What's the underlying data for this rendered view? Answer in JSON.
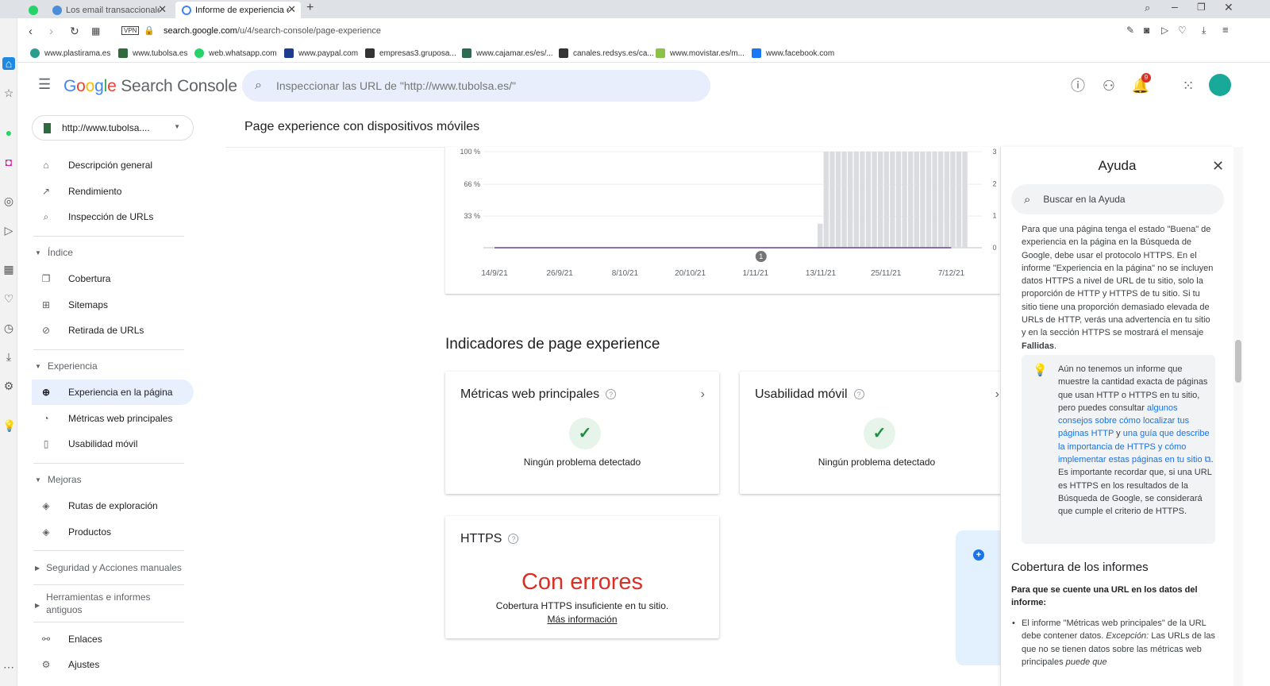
{
  "browser": {
    "tabs": [
      {
        "title": "Los email transaccionales o"
      },
      {
        "title": "Informe de experiencia en"
      }
    ],
    "url_host": "search.google.com",
    "url_path": "/u/4/search-console/page-experience",
    "vpn_label": "VPN",
    "bookmarks": [
      "www.plastirama.es",
      "www.tubolsa.es",
      "web.whatsapp.com",
      "www.paypal.com",
      "empresas3.gruposa...",
      "www.cajamar.es/es/...",
      "canales.redsys.es/ca...",
      "www.movistar.es/m...",
      "www.facebook.com"
    ]
  },
  "header": {
    "logo_google": "Google",
    "logo_product": "Search Console",
    "search_placeholder": "Inspeccionar las URL de \"http://www.tubolsa.es/\"",
    "notification_count": "9"
  },
  "sidebar": {
    "property": "http://www.tubolsa....",
    "items_top": [
      {
        "label": "Descripción general",
        "icon": "home-icon"
      },
      {
        "label": "Rendimiento",
        "icon": "trending-up-icon"
      },
      {
        "label": "Inspección de URLs",
        "icon": "search-icon"
      }
    ],
    "section_index": "Índice",
    "items_index": [
      {
        "label": "Cobertura",
        "icon": "file-copy-icon"
      },
      {
        "label": "Sitemaps",
        "icon": "sitemap-icon"
      },
      {
        "label": "Retirada de URLs",
        "icon": "eye-off-icon"
      }
    ],
    "section_experience": "Experiencia",
    "items_experience": [
      {
        "label": "Experiencia en la página",
        "icon": "plus-circle-icon"
      },
      {
        "label": "Métricas web principales",
        "icon": "gauge-icon"
      },
      {
        "label": "Usabilidad móvil",
        "icon": "phone-icon"
      }
    ],
    "section_improvements": "Mejoras",
    "items_improvements": [
      {
        "label": "Rutas de exploración",
        "icon": "layers-icon"
      },
      {
        "label": "Productos",
        "icon": "layers-icon"
      }
    ],
    "section_security": "Seguridad y Acciones manuales",
    "section_tools": "Herramientas e informes antiguos",
    "items_bottom": [
      {
        "label": "Enlaces",
        "icon": "links-icon"
      },
      {
        "label": "Ajustes",
        "icon": "gear-icon"
      }
    ]
  },
  "main": {
    "page_title": "Page experience con dispositivos móviles",
    "section_title": "Indicadores de page experience",
    "cards": {
      "cwv": {
        "title": "Métricas web principales",
        "status": "Ningún problema detectado"
      },
      "mobile": {
        "title": "Usabilidad móvil",
        "status": "Ningún problema detectado"
      },
      "https": {
        "title": "HTTPS",
        "status": "Con errores",
        "description": "Cobertura HTTPS insuficiente en tu sitio.",
        "link": "Más información"
      }
    }
  },
  "chart_data": {
    "type": "bar",
    "x_ticks": [
      "14/9/21",
      "26/9/21",
      "8/10/21",
      "20/10/21",
      "1/11/21",
      "13/11/21",
      "25/11/21",
      "7/12/21"
    ],
    "y_left_ticks": [
      "33 %",
      "66 %",
      "100 %"
    ],
    "y_right_ticks": [
      "0",
      "1",
      "2",
      "3"
    ],
    "annotation_marker": "1",
    "bars_start": "13/11/21",
    "bars_end": "7/12/21",
    "bar_value_percent": 100,
    "line_value": 0,
    "colors": {
      "bars": "#dadce0",
      "line": "#6b3fa0"
    }
  },
  "help": {
    "title": "Ayuda",
    "search_placeholder": "Buscar en la Ayuda",
    "body_pre": "Para que una página tenga el estado \"Buena\" de experiencia en la página en la Búsqueda de Google, debe usar el protocolo HTTPS. En el informe \"Experiencia en la página\" no se incluyen datos HTTPS a nivel de URL de tu sitio, solo la proporción de HTTP y HTTPS de tu sitio. Si tu sitio tiene una proporción demasiado elevada de URLs de HTTP, verás una advertencia en tu sitio y en la sección HTTPS se mostrará el mensaje ",
    "body_bold": "Fallidas",
    "body_post": ".",
    "tip_pre": "Aún no tenemos un informe que muestre la cantidad exacta de páginas que usan HTTP o HTTPS en tu sitio, pero puedes consultar ",
    "tip_link1": "algunos consejos sobre cómo localizar tus páginas HTTP",
    "tip_mid": " y ",
    "tip_link2": "una guía que describe la importancia de HTTPS y cómo implementar estas páginas en tu sitio",
    "tip_post": ". Es importante recordar que, si una URL es HTTPS en los resultados de la Búsqueda de Google, se considerará que cumple el criterio de HTTPS.",
    "h2": "Cobertura de los informes",
    "sub": "Para que se cuente una URL en los datos del informe:",
    "li_pre": "El informe \"Métricas web principales\" de la URL debe contener datos. ",
    "li_em": "Excepción:",
    "li_mid": " Las URLs de las que no se tienen datos sobre las métricas web principales ",
    "li_em2": "puede que"
  }
}
